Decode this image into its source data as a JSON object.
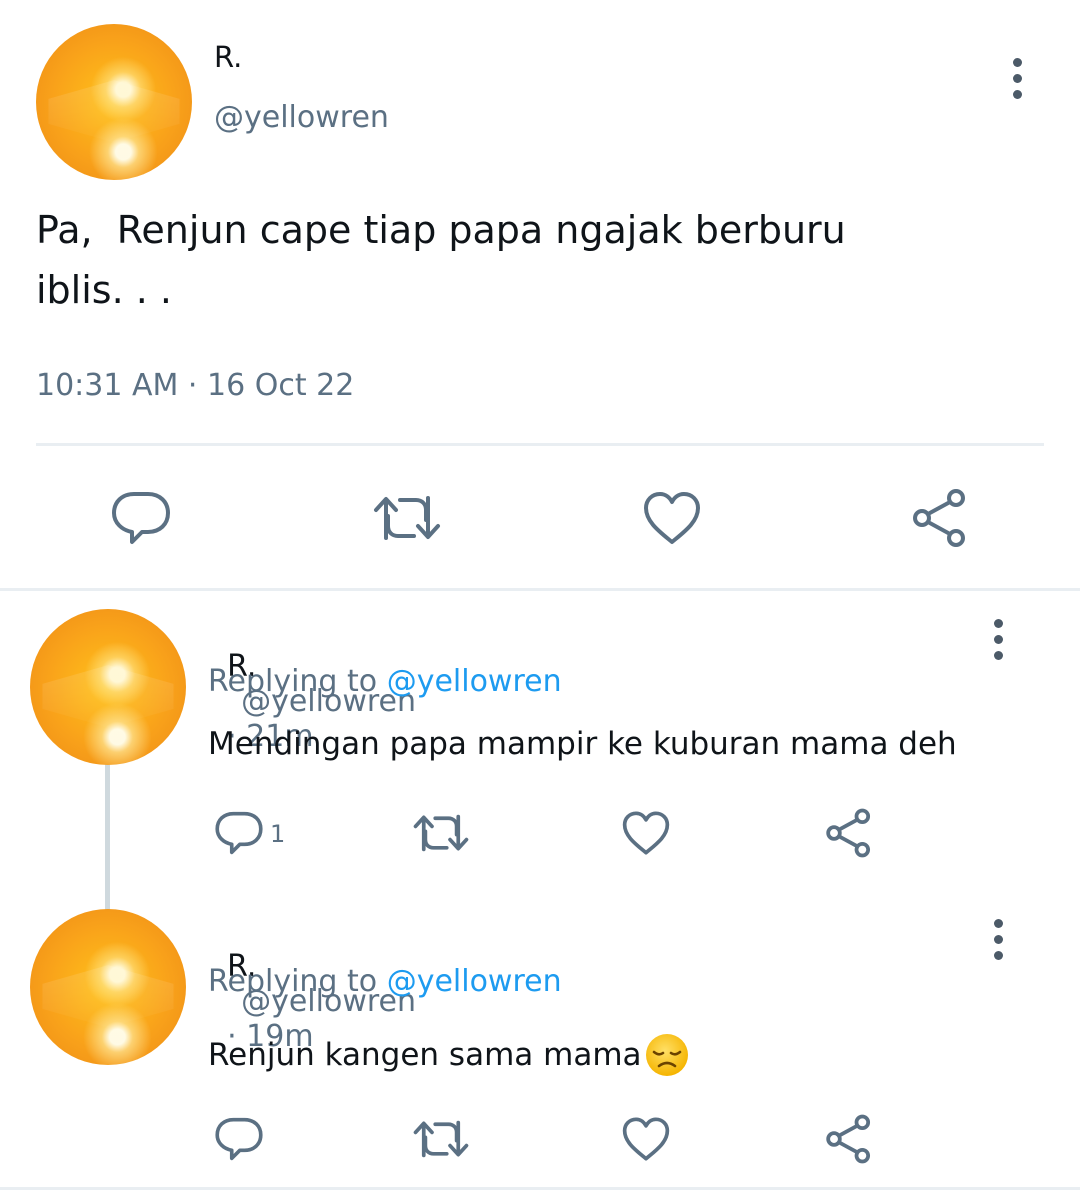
{
  "main_tweet": {
    "display_name": "R.",
    "handle": "@yellowren",
    "text_line1": "Pa,  Renjun cape tiap papa ngajak berburu",
    "text_line2": "iblis. . .",
    "timestamp": "10:31 AM · 16 Oct 22",
    "actions": {
      "reply": "reply-icon",
      "retweet": "retweet-icon",
      "like": "heart-icon",
      "share": "share-icon"
    }
  },
  "replies": [
    {
      "display_name": "R.",
      "handle": "@yellowren",
      "time": "· 21m",
      "replying_label": "Replying to",
      "replying_handle": "@yellowren",
      "text": "Mendingan papa mampir ke kuburan mama deh",
      "reply_count": "1"
    },
    {
      "display_name": "R.",
      "handle": "@yellowren",
      "time": "· 19m",
      "replying_label": "Replying to",
      "replying_handle": "@yellowren",
      "text": "Renjun kangen sama mama",
      "emoji": "disappointed-face",
      "reply_count": ""
    }
  ],
  "colors": {
    "accent": "#1d9bf0",
    "secondary_text": "#5b7083",
    "icon": "#5b7083"
  }
}
